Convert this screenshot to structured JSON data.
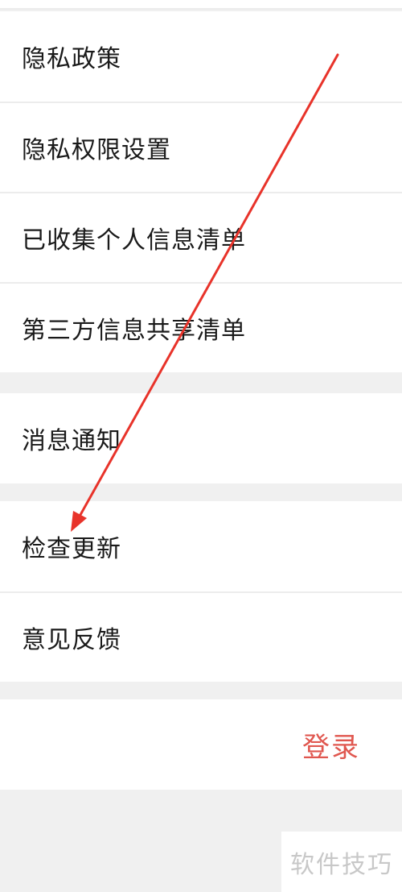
{
  "settings": {
    "group1": [
      {
        "label": "隐私政策"
      },
      {
        "label": "隐私权限设置"
      },
      {
        "label": "已收集个人信息清单"
      },
      {
        "label": "第三方信息共享清单"
      }
    ],
    "group2": [
      {
        "label": "消息通知"
      }
    ],
    "group3": [
      {
        "label": "检查更新"
      },
      {
        "label": "意见反馈"
      }
    ],
    "login_label": "登录"
  },
  "watermark": "软件技巧",
  "colors": {
    "background": "#f0f0f0",
    "row_background": "#ffffff",
    "login_text": "#e0574f",
    "annotation_arrow": "#e8332a"
  }
}
